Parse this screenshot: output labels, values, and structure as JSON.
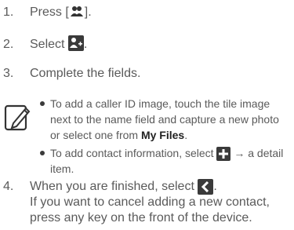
{
  "steps": [
    {
      "num": "1.",
      "before": "Press [",
      "after": "].",
      "icon": "contacts-icon"
    },
    {
      "num": "2.",
      "text": "Select",
      "after": ".",
      "icon": "add-contact-icon"
    },
    {
      "num": "3.",
      "text": "Complete the fields."
    },
    {
      "num": "4.",
      "text": "When you are finished, select",
      "after": ".",
      "icon": "back-icon"
    }
  ],
  "note": {
    "icon": "note-pencil-icon",
    "bullets": [
      {
        "text": "To add a caller ID image, touch the tile image next to the name field and capture a new photo or select one from ",
        "link": "My Files",
        "end": "."
      },
      {
        "text": "To add contact information, select",
        "arrow": "→",
        "end": "a detail item.",
        "icon": "plus-icon"
      }
    ]
  },
  "step4_extra": {
    "line2": "If you want to cancel adding a new contact,",
    "line3": "press any key on the front of the device."
  }
}
